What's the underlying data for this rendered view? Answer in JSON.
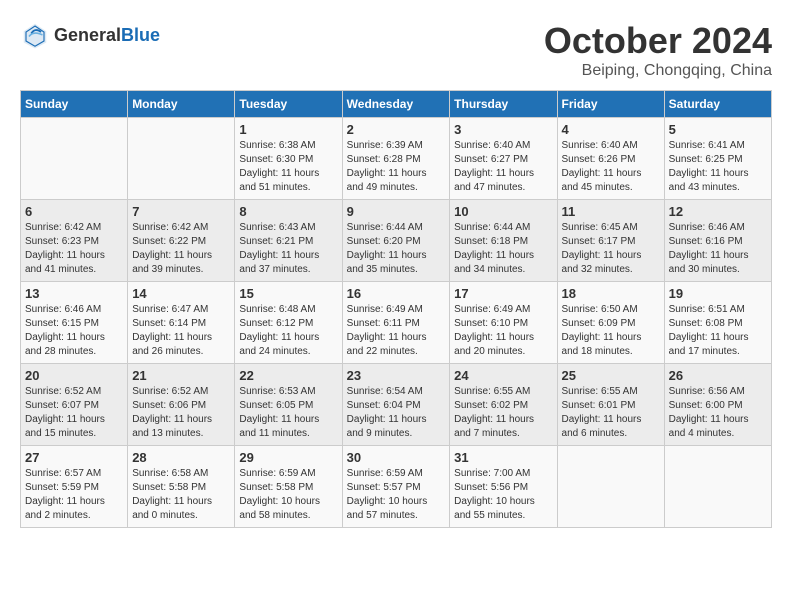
{
  "header": {
    "logo_general": "General",
    "logo_blue": "Blue",
    "month_title": "October 2024",
    "location": "Beiping, Chongqing, China"
  },
  "days_of_week": [
    "Sunday",
    "Monday",
    "Tuesday",
    "Wednesday",
    "Thursday",
    "Friday",
    "Saturday"
  ],
  "weeks": [
    [
      {
        "day": "",
        "info": ""
      },
      {
        "day": "",
        "info": ""
      },
      {
        "day": "1",
        "info": "Sunrise: 6:38 AM\nSunset: 6:30 PM\nDaylight: 11 hours and 51 minutes."
      },
      {
        "day": "2",
        "info": "Sunrise: 6:39 AM\nSunset: 6:28 PM\nDaylight: 11 hours and 49 minutes."
      },
      {
        "day": "3",
        "info": "Sunrise: 6:40 AM\nSunset: 6:27 PM\nDaylight: 11 hours and 47 minutes."
      },
      {
        "day": "4",
        "info": "Sunrise: 6:40 AM\nSunset: 6:26 PM\nDaylight: 11 hours and 45 minutes."
      },
      {
        "day": "5",
        "info": "Sunrise: 6:41 AM\nSunset: 6:25 PM\nDaylight: 11 hours and 43 minutes."
      }
    ],
    [
      {
        "day": "6",
        "info": "Sunrise: 6:42 AM\nSunset: 6:23 PM\nDaylight: 11 hours and 41 minutes."
      },
      {
        "day": "7",
        "info": "Sunrise: 6:42 AM\nSunset: 6:22 PM\nDaylight: 11 hours and 39 minutes."
      },
      {
        "day": "8",
        "info": "Sunrise: 6:43 AM\nSunset: 6:21 PM\nDaylight: 11 hours and 37 minutes."
      },
      {
        "day": "9",
        "info": "Sunrise: 6:44 AM\nSunset: 6:20 PM\nDaylight: 11 hours and 35 minutes."
      },
      {
        "day": "10",
        "info": "Sunrise: 6:44 AM\nSunset: 6:18 PM\nDaylight: 11 hours and 34 minutes."
      },
      {
        "day": "11",
        "info": "Sunrise: 6:45 AM\nSunset: 6:17 PM\nDaylight: 11 hours and 32 minutes."
      },
      {
        "day": "12",
        "info": "Sunrise: 6:46 AM\nSunset: 6:16 PM\nDaylight: 11 hours and 30 minutes."
      }
    ],
    [
      {
        "day": "13",
        "info": "Sunrise: 6:46 AM\nSunset: 6:15 PM\nDaylight: 11 hours and 28 minutes."
      },
      {
        "day": "14",
        "info": "Sunrise: 6:47 AM\nSunset: 6:14 PM\nDaylight: 11 hours and 26 minutes."
      },
      {
        "day": "15",
        "info": "Sunrise: 6:48 AM\nSunset: 6:12 PM\nDaylight: 11 hours and 24 minutes."
      },
      {
        "day": "16",
        "info": "Sunrise: 6:49 AM\nSunset: 6:11 PM\nDaylight: 11 hours and 22 minutes."
      },
      {
        "day": "17",
        "info": "Sunrise: 6:49 AM\nSunset: 6:10 PM\nDaylight: 11 hours and 20 minutes."
      },
      {
        "day": "18",
        "info": "Sunrise: 6:50 AM\nSunset: 6:09 PM\nDaylight: 11 hours and 18 minutes."
      },
      {
        "day": "19",
        "info": "Sunrise: 6:51 AM\nSunset: 6:08 PM\nDaylight: 11 hours and 17 minutes."
      }
    ],
    [
      {
        "day": "20",
        "info": "Sunrise: 6:52 AM\nSunset: 6:07 PM\nDaylight: 11 hours and 15 minutes."
      },
      {
        "day": "21",
        "info": "Sunrise: 6:52 AM\nSunset: 6:06 PM\nDaylight: 11 hours and 13 minutes."
      },
      {
        "day": "22",
        "info": "Sunrise: 6:53 AM\nSunset: 6:05 PM\nDaylight: 11 hours and 11 minutes."
      },
      {
        "day": "23",
        "info": "Sunrise: 6:54 AM\nSunset: 6:04 PM\nDaylight: 11 hours and 9 minutes."
      },
      {
        "day": "24",
        "info": "Sunrise: 6:55 AM\nSunset: 6:02 PM\nDaylight: 11 hours and 7 minutes."
      },
      {
        "day": "25",
        "info": "Sunrise: 6:55 AM\nSunset: 6:01 PM\nDaylight: 11 hours and 6 minutes."
      },
      {
        "day": "26",
        "info": "Sunrise: 6:56 AM\nSunset: 6:00 PM\nDaylight: 11 hours and 4 minutes."
      }
    ],
    [
      {
        "day": "27",
        "info": "Sunrise: 6:57 AM\nSunset: 5:59 PM\nDaylight: 11 hours and 2 minutes."
      },
      {
        "day": "28",
        "info": "Sunrise: 6:58 AM\nSunset: 5:58 PM\nDaylight: 11 hours and 0 minutes."
      },
      {
        "day": "29",
        "info": "Sunrise: 6:59 AM\nSunset: 5:58 PM\nDaylight: 10 hours and 58 minutes."
      },
      {
        "day": "30",
        "info": "Sunrise: 6:59 AM\nSunset: 5:57 PM\nDaylight: 10 hours and 57 minutes."
      },
      {
        "day": "31",
        "info": "Sunrise: 7:00 AM\nSunset: 5:56 PM\nDaylight: 10 hours and 55 minutes."
      },
      {
        "day": "",
        "info": ""
      },
      {
        "day": "",
        "info": ""
      }
    ]
  ]
}
